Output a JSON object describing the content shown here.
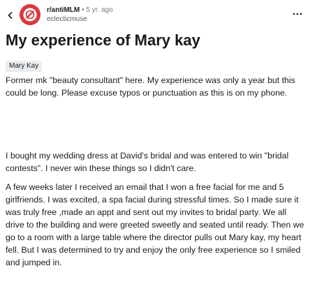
{
  "header": {
    "subreddit": "r/antiMLM",
    "separator": "•",
    "age": "5 yr. ago",
    "username": "eclecticmuse",
    "back_icon": "back-arrow-icon",
    "more_icon": "more-horizontal-icon"
  },
  "colors": {
    "avatar_bg": "#d93a3f",
    "flair_bg": "#eaedf0",
    "text": "#1a1a1b",
    "meta": "#7c7c7c"
  },
  "post": {
    "title": "My experience of Mary kay",
    "flair": "Mary Kay",
    "paragraphs": [
      "Former mk \"beauty consultant\" here. My experience was only a year but this could be long. Please excuse typos or punctuation as this is on my phone.",
      "I bought my wedding dress at David's bridal and was entered to win \"bridal contests\". I never win these things so I didn't care.",
      "A few weeks later I received an email that I won a free facial for me and 5 girlfriends. I was excited, a spa facial during stressful times. So I made sure it was truly free ,made an appt and sent out my invites to bridal party. We all drive to the building and were greeted sweetly and seated until ready. Then we go to a room with a large table where the director pulls out Mary kay, my heart fell. But I was determined to try and enjoy the only free experience so I smiled and jumped in."
    ]
  }
}
